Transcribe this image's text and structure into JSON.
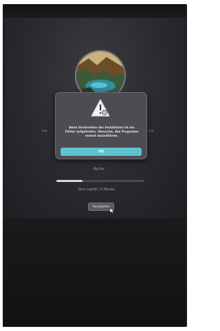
{
  "installer": {
    "disk_name": "Big Sur",
    "progress_fraction": 0.3,
    "time_remaining": "Noch ungefähr 11 Minuten",
    "restart_label": "Neustarten"
  },
  "alert": {
    "message": "Beim Vorbereiten der Installation ist ein Fehler aufgetreten. Versuche, das Programm erneut auszuführen.",
    "ok_label": "OK",
    "icon": "warning-triangle-icon"
  },
  "colors": {
    "accent": "#5cc3cf",
    "dialog_background": "#4d4c51",
    "screen_background": "#2a292d"
  }
}
